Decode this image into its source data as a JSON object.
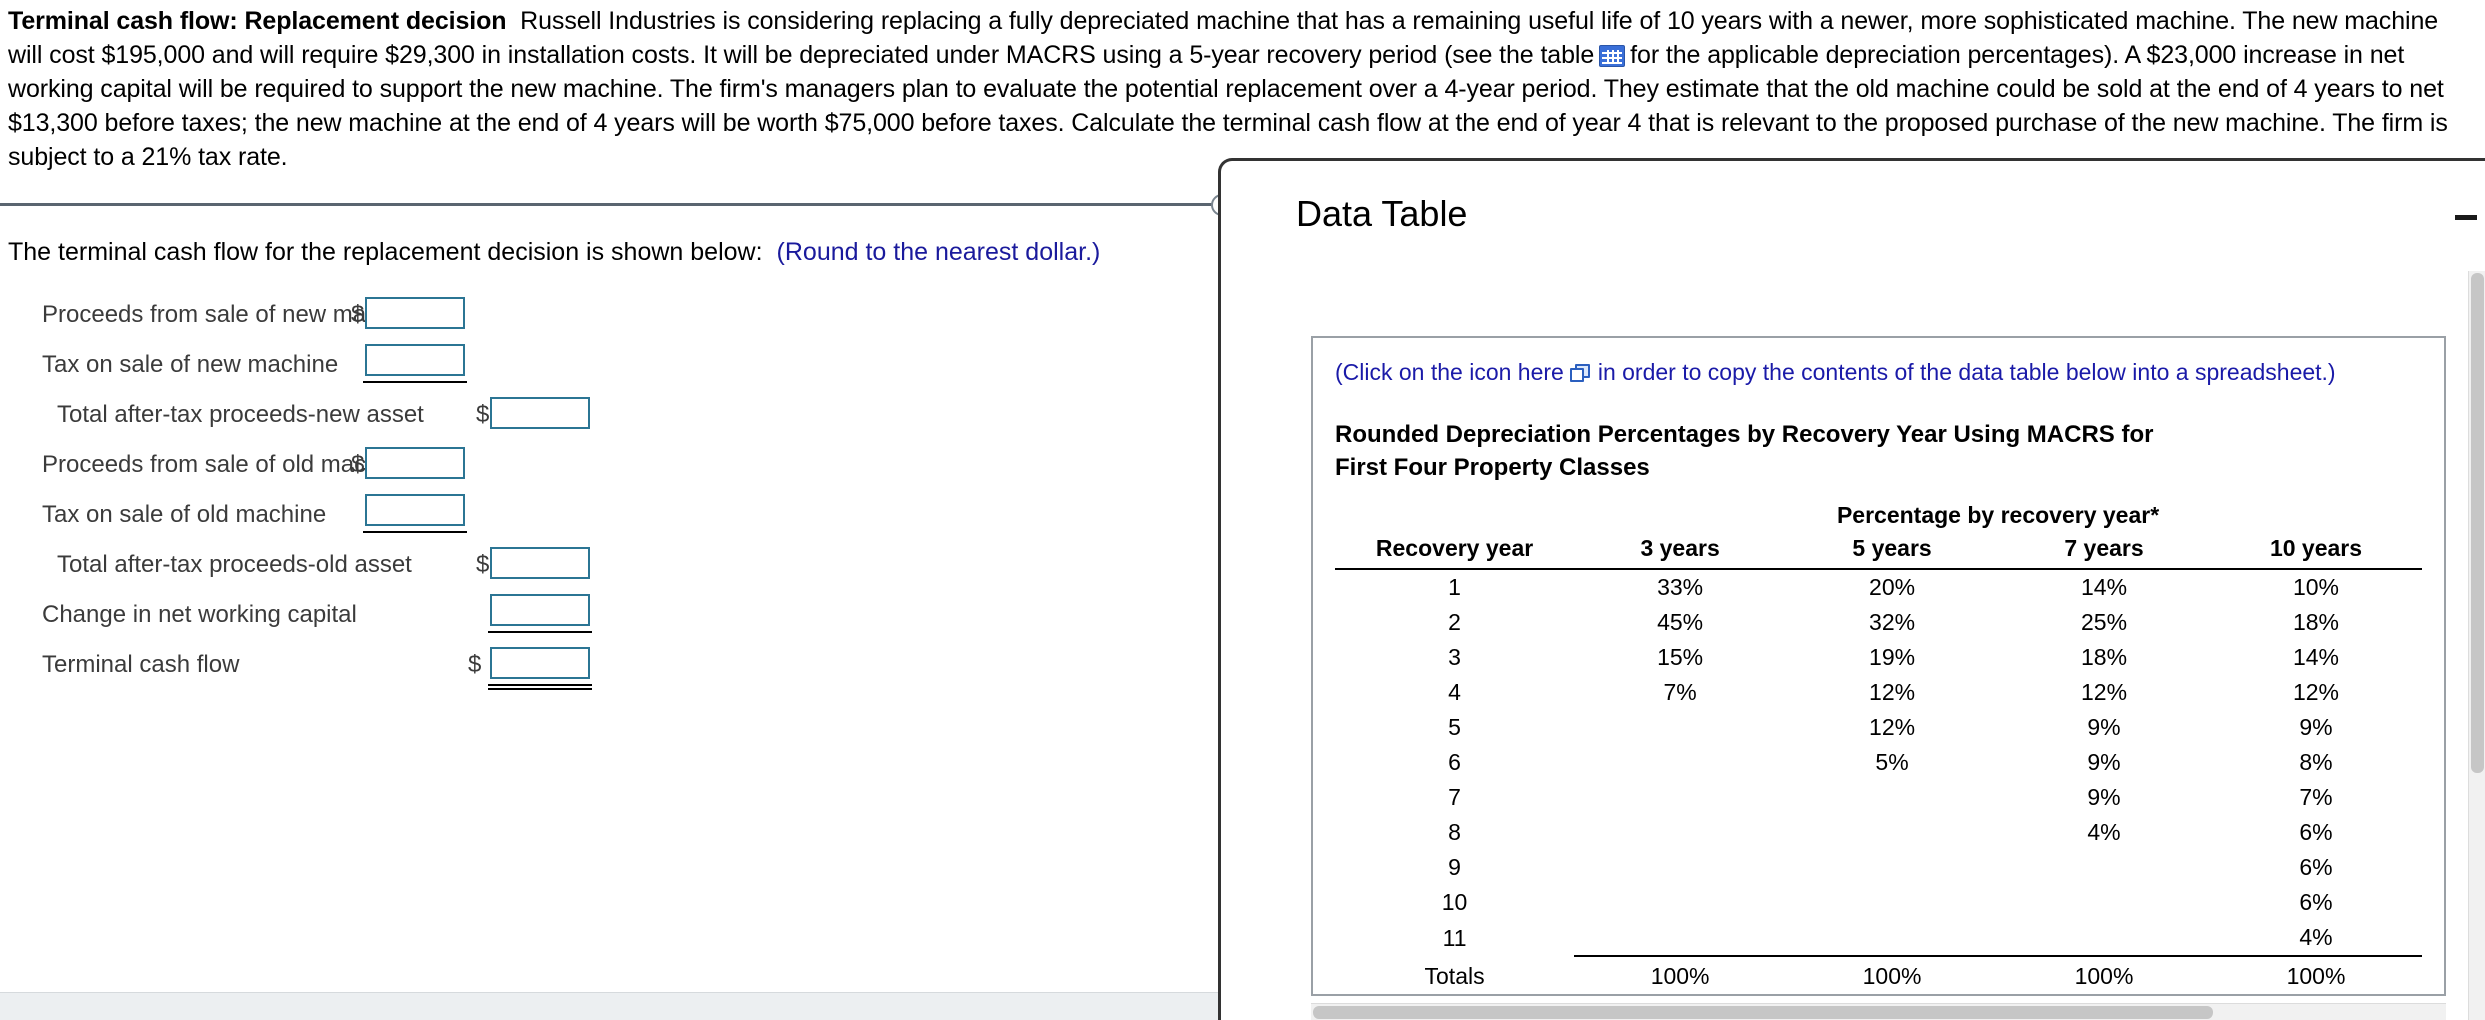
{
  "problem": {
    "title_bold": "Terminal cash flow:  Replacement decision",
    "body_part1": "Russell Industries is considering replacing a fully depreciated machine that has a remaining useful life of 10 years with a newer, more sophisticated machine. The new machine will cost $195,000 and will require $29,300 in installation costs. It will be depreciated under MACRS using a 5-year recovery period (see the table",
    "body_part2": "for the applicable depreciation percentages). A $23,000 increase in net working capital will be required to support the new machine. The firm's managers plan to evaluate the potential replacement over a 4-year period. They estimate that the old machine could be sold at the end of 4 years to net $13,300 before taxes; the new machine at the end of 4 years will be worth $75,000 before taxes. Calculate the terminal cash flow at the end of year 4 that is relevant to the proposed purchase of the new machine. The firm is subject to a 21% tax rate.",
    "table_icon": "table-icon"
  },
  "answer": {
    "prompt": "The terminal cash flow for the replacement decision is shown below:",
    "hint": "(Round to the nearest dollar.)",
    "dollar": "$",
    "rows": [
      {
        "label": "Proceeds from sale of new machine",
        "value": ""
      },
      {
        "label": "Tax on sale of new machine",
        "value": ""
      },
      {
        "label": "Total after-tax proceeds-new asset",
        "value": ""
      },
      {
        "label": "Proceeds from sale of old machine",
        "value": ""
      },
      {
        "label": "Tax on sale of old machine",
        "value": ""
      },
      {
        "label": "Total after-tax proceeds-old asset",
        "value": ""
      },
      {
        "label": "Change in net working capital",
        "value": ""
      },
      {
        "label": "Terminal cash flow",
        "value": ""
      }
    ]
  },
  "data_table": {
    "window_title": "Data Table",
    "click_note_before": "(Click on the icon here",
    "click_note_after": "in order to copy the contents of the data table below into a spreadsheet.)",
    "copy_icon": "copy-icon",
    "heading_line1": "Rounded Depreciation Percentages by Recovery Year Using MACRS for",
    "heading_line2": "First Four Property Classes",
    "span_header": "Percentage by recovery year*",
    "recovery_year_header": "Recovery year",
    "columns": [
      "3 years",
      "5 years",
      "7 years",
      "10 years"
    ],
    "rows": [
      {
        "year": "1",
        "c3": "33%",
        "c5": "20%",
        "c7": "14%",
        "c10": "10%"
      },
      {
        "year": "2",
        "c3": "45%",
        "c5": "32%",
        "c7": "25%",
        "c10": "18%"
      },
      {
        "year": "3",
        "c3": "15%",
        "c5": "19%",
        "c7": "18%",
        "c10": "14%"
      },
      {
        "year": "4",
        "c3": "7%",
        "c5": "12%",
        "c7": "12%",
        "c10": "12%"
      },
      {
        "year": "5",
        "c3": "",
        "c5": "12%",
        "c7": "9%",
        "c10": "9%"
      },
      {
        "year": "6",
        "c3": "",
        "c5": "5%",
        "c7": "9%",
        "c10": "8%"
      },
      {
        "year": "7",
        "c3": "",
        "c5": "",
        "c7": "9%",
        "c10": "7%"
      },
      {
        "year": "8",
        "c3": "",
        "c5": "",
        "c7": "4%",
        "c10": "6%"
      },
      {
        "year": "9",
        "c3": "",
        "c5": "",
        "c7": "",
        "c10": "6%"
      },
      {
        "year": "10",
        "c3": "",
        "c5": "",
        "c7": "",
        "c10": "6%"
      },
      {
        "year": "11",
        "c3": "",
        "c5": "",
        "c7": "",
        "c10": "4%"
      }
    ],
    "totals": {
      "year": "Totals",
      "c3": "100%",
      "c5": "100%",
      "c7": "100%",
      "c10": "100%"
    }
  },
  "colors": {
    "input_border": "#2b7594",
    "link_blue": "#1a1aa8",
    "icon_blue": "#3a6fd8"
  }
}
